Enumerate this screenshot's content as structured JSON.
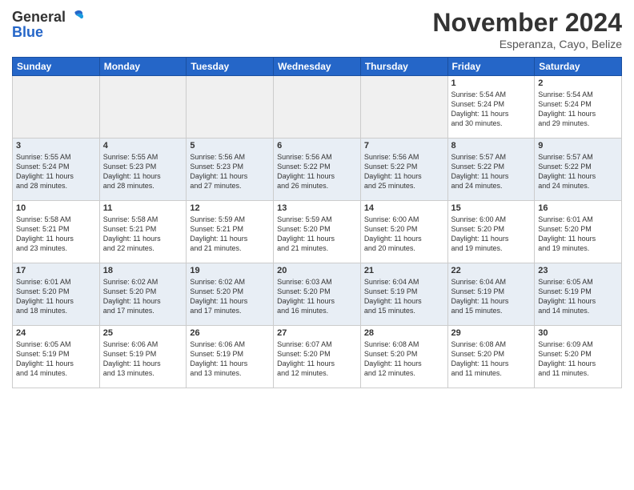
{
  "header": {
    "logo_general": "General",
    "logo_blue": "Blue",
    "month_title": "November 2024",
    "location": "Esperanza, Cayo, Belize"
  },
  "weekdays": [
    "Sunday",
    "Monday",
    "Tuesday",
    "Wednesday",
    "Thursday",
    "Friday",
    "Saturday"
  ],
  "weeks": [
    [
      {
        "day": "",
        "info": ""
      },
      {
        "day": "",
        "info": ""
      },
      {
        "day": "",
        "info": ""
      },
      {
        "day": "",
        "info": ""
      },
      {
        "day": "",
        "info": ""
      },
      {
        "day": "1",
        "info": "Sunrise: 5:54 AM\nSunset: 5:24 PM\nDaylight: 11 hours\nand 30 minutes."
      },
      {
        "day": "2",
        "info": "Sunrise: 5:54 AM\nSunset: 5:24 PM\nDaylight: 11 hours\nand 29 minutes."
      }
    ],
    [
      {
        "day": "3",
        "info": "Sunrise: 5:55 AM\nSunset: 5:24 PM\nDaylight: 11 hours\nand 28 minutes."
      },
      {
        "day": "4",
        "info": "Sunrise: 5:55 AM\nSunset: 5:23 PM\nDaylight: 11 hours\nand 28 minutes."
      },
      {
        "day": "5",
        "info": "Sunrise: 5:56 AM\nSunset: 5:23 PM\nDaylight: 11 hours\nand 27 minutes."
      },
      {
        "day": "6",
        "info": "Sunrise: 5:56 AM\nSunset: 5:22 PM\nDaylight: 11 hours\nand 26 minutes."
      },
      {
        "day": "7",
        "info": "Sunrise: 5:56 AM\nSunset: 5:22 PM\nDaylight: 11 hours\nand 25 minutes."
      },
      {
        "day": "8",
        "info": "Sunrise: 5:57 AM\nSunset: 5:22 PM\nDaylight: 11 hours\nand 24 minutes."
      },
      {
        "day": "9",
        "info": "Sunrise: 5:57 AM\nSunset: 5:22 PM\nDaylight: 11 hours\nand 24 minutes."
      }
    ],
    [
      {
        "day": "10",
        "info": "Sunrise: 5:58 AM\nSunset: 5:21 PM\nDaylight: 11 hours\nand 23 minutes."
      },
      {
        "day": "11",
        "info": "Sunrise: 5:58 AM\nSunset: 5:21 PM\nDaylight: 11 hours\nand 22 minutes."
      },
      {
        "day": "12",
        "info": "Sunrise: 5:59 AM\nSunset: 5:21 PM\nDaylight: 11 hours\nand 21 minutes."
      },
      {
        "day": "13",
        "info": "Sunrise: 5:59 AM\nSunset: 5:20 PM\nDaylight: 11 hours\nand 21 minutes."
      },
      {
        "day": "14",
        "info": "Sunrise: 6:00 AM\nSunset: 5:20 PM\nDaylight: 11 hours\nand 20 minutes."
      },
      {
        "day": "15",
        "info": "Sunrise: 6:00 AM\nSunset: 5:20 PM\nDaylight: 11 hours\nand 19 minutes."
      },
      {
        "day": "16",
        "info": "Sunrise: 6:01 AM\nSunset: 5:20 PM\nDaylight: 11 hours\nand 19 minutes."
      }
    ],
    [
      {
        "day": "17",
        "info": "Sunrise: 6:01 AM\nSunset: 5:20 PM\nDaylight: 11 hours\nand 18 minutes."
      },
      {
        "day": "18",
        "info": "Sunrise: 6:02 AM\nSunset: 5:20 PM\nDaylight: 11 hours\nand 17 minutes."
      },
      {
        "day": "19",
        "info": "Sunrise: 6:02 AM\nSunset: 5:20 PM\nDaylight: 11 hours\nand 17 minutes."
      },
      {
        "day": "20",
        "info": "Sunrise: 6:03 AM\nSunset: 5:20 PM\nDaylight: 11 hours\nand 16 minutes."
      },
      {
        "day": "21",
        "info": "Sunrise: 6:04 AM\nSunset: 5:19 PM\nDaylight: 11 hours\nand 15 minutes."
      },
      {
        "day": "22",
        "info": "Sunrise: 6:04 AM\nSunset: 5:19 PM\nDaylight: 11 hours\nand 15 minutes."
      },
      {
        "day": "23",
        "info": "Sunrise: 6:05 AM\nSunset: 5:19 PM\nDaylight: 11 hours\nand 14 minutes."
      }
    ],
    [
      {
        "day": "24",
        "info": "Sunrise: 6:05 AM\nSunset: 5:19 PM\nDaylight: 11 hours\nand 14 minutes."
      },
      {
        "day": "25",
        "info": "Sunrise: 6:06 AM\nSunset: 5:19 PM\nDaylight: 11 hours\nand 13 minutes."
      },
      {
        "day": "26",
        "info": "Sunrise: 6:06 AM\nSunset: 5:19 PM\nDaylight: 11 hours\nand 13 minutes."
      },
      {
        "day": "27",
        "info": "Sunrise: 6:07 AM\nSunset: 5:20 PM\nDaylight: 11 hours\nand 12 minutes."
      },
      {
        "day": "28",
        "info": "Sunrise: 6:08 AM\nSunset: 5:20 PM\nDaylight: 11 hours\nand 12 minutes."
      },
      {
        "day": "29",
        "info": "Sunrise: 6:08 AM\nSunset: 5:20 PM\nDaylight: 11 hours\nand 11 minutes."
      },
      {
        "day": "30",
        "info": "Sunrise: 6:09 AM\nSunset: 5:20 PM\nDaylight: 11 hours\nand 11 minutes."
      }
    ]
  ]
}
